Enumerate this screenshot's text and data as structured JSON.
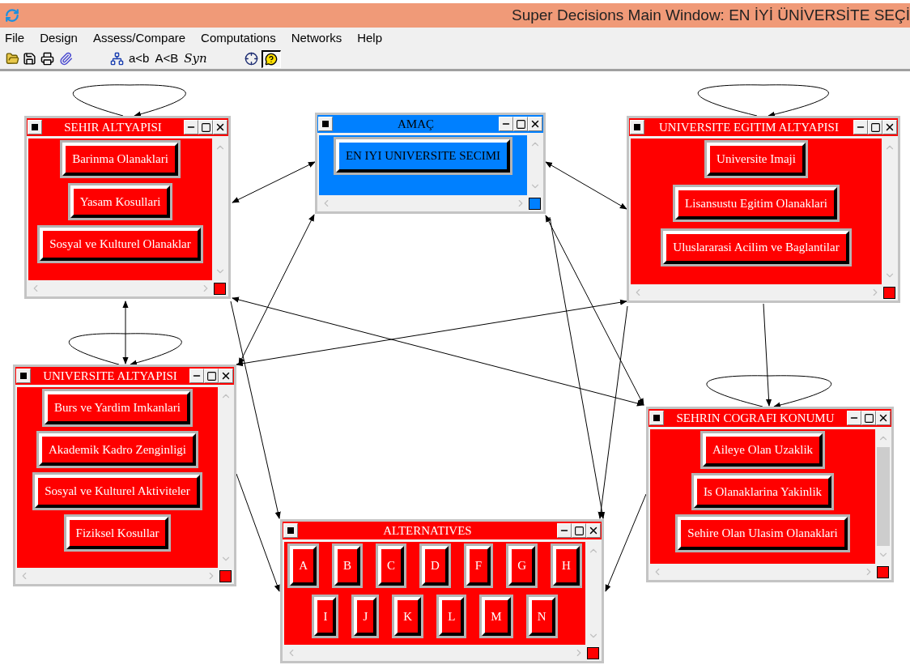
{
  "window": {
    "title": "Super Decisions Main Window: EN İYİ ÜNİVERSİTE SEÇİ"
  },
  "menu": [
    "File",
    "Design",
    "Assess/Compare",
    "Computations",
    "Networks",
    "Help"
  ],
  "toolbar": [
    {
      "kind": "open"
    },
    {
      "kind": "save"
    },
    {
      "kind": "print"
    },
    {
      "kind": "clip"
    },
    {
      "kind": "network"
    },
    {
      "kind": "text",
      "label": "a<b",
      "italic": false
    },
    {
      "kind": "text",
      "label": "A<B",
      "italic": false
    },
    {
      "kind": "text",
      "label": "Syn",
      "italic": true
    },
    {
      "kind": "star"
    },
    {
      "kind": "help",
      "pressed": true
    }
  ],
  "clusters": [
    {
      "title": "SEHIR ALTYAPISI",
      "color": "#ff0000",
      "node_rows": [
        [
          "Barinma Olanaklari"
        ],
        [
          "Yasam Kosullari"
        ],
        [
          "Sosyal ve Kulturel Olanaklar"
        ]
      ]
    },
    {
      "title": "AMAÇ",
      "color": "#0080ff",
      "node_rows": [
        [
          "EN IYI UNIVERSITE SECIMI"
        ]
      ]
    },
    {
      "title": "UNIVERSITE EGITIM ALTYAPISI",
      "color": "#ff0000",
      "node_rows": [
        [
          "Universite Imaji"
        ],
        [
          "Lisansustu Egitim Olanaklari"
        ],
        [
          "Uluslararasi Acilim ve Baglantilar"
        ]
      ]
    },
    {
      "title": "UNIVERSITE ALTYAPISI",
      "color": "#ff0000",
      "node_rows": [
        [
          "Burs ve Yardim Imkanlari"
        ],
        [
          "Akademik Kadro Zenginligi"
        ],
        [
          "Sosyal ve Kulturel Aktiviteler"
        ],
        [
          "Fiziksel Kosullar"
        ]
      ]
    },
    {
      "title": "SEHRIN COGRAFI KONUMU",
      "color": "#ff0000",
      "node_rows": [
        [
          "Aileye Olan Uzaklik"
        ],
        [
          "Is Olanaklarina Yakinlik"
        ],
        [
          "Sehire Olan Ulasim Olanaklari"
        ]
      ]
    },
    {
      "title": "ALTERNATIVES",
      "color": "#ff0000",
      "node_rows": [
        [
          "A",
          "B",
          "C",
          "D",
          "F",
          "G",
          "H"
        ],
        [
          "I",
          "J",
          "K",
          "L",
          "M",
          "N"
        ]
      ]
    }
  ]
}
